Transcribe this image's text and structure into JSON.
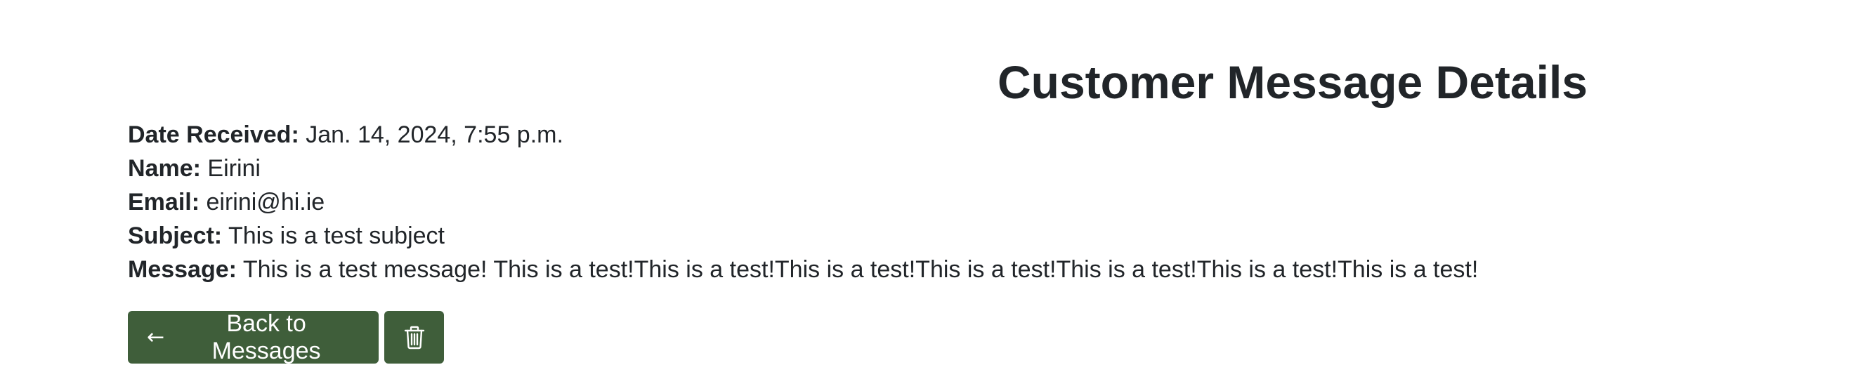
{
  "page": {
    "title": "Customer Message Details"
  },
  "details": {
    "date_received": {
      "label": "Date Received:",
      "value": "Jan. 14, 2024, 7:55 p.m."
    },
    "name": {
      "label": "Name:",
      "value": "Eirini"
    },
    "email": {
      "label": "Email:",
      "value": "eirini@hi.ie"
    },
    "subject": {
      "label": "Subject:",
      "value": "This is a test subject"
    },
    "message": {
      "label": "Message:",
      "value": "This is a test message! This is a test!This is a test!This is a test!This is a test!This is a test!This is a test!This is a test!"
    }
  },
  "actions": {
    "back_label": "Back to Messages",
    "back_icon": "arrow-left-icon",
    "delete_icon": "trash-icon"
  },
  "colors": {
    "button_bg": "#3f5e3a",
    "text": "#212529"
  }
}
